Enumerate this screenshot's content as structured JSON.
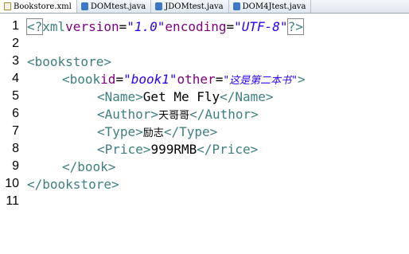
{
  "tabs": [
    {
      "label": "Bookstore.xml",
      "icon": "xml-file-icon",
      "active": true
    },
    {
      "label": "DOMtest.java",
      "icon": "java-file-icon",
      "active": false
    },
    {
      "label": "JDOMtest.java",
      "icon": "java-file-icon",
      "active": false
    },
    {
      "label": "DOM4Jtest.java",
      "icon": "java-file-icon",
      "active": false
    }
  ],
  "editor": {
    "line_numbers": [
      "1",
      "2",
      "3",
      "4",
      "5",
      "6",
      "7",
      "8",
      "9",
      "10",
      "11"
    ],
    "lines": {
      "l1": {
        "open": "<?",
        "decl": "xml",
        "attr1": "version",
        "eq1": "=",
        "val1": "\"1.0\"",
        "attr2": "encoding",
        "eq2": "=",
        "val2": "\"UTF-8\"",
        "close": "?>"
      },
      "l3": {
        "tag": "<bookstore>"
      },
      "l4": {
        "open": "<book",
        "attr1": "id",
        "eq1": "=",
        "val1": "\"book1\"",
        "attr2": "other",
        "eq2": "=",
        "val2": "\"这是第二本书\"",
        "close": ">"
      },
      "l5": {
        "open": "<Name>",
        "text": "Get Me Fly",
        "close": "</Name>"
      },
      "l6": {
        "open": "<Author>",
        "text": "天哥哥",
        "close": "</Author>"
      },
      "l7": {
        "open": "<Type>",
        "text": "励志",
        "close": "</Type>"
      },
      "l8": {
        "open": "<Price>",
        "text": "999RMB",
        "close": "</Price>"
      },
      "l9": {
        "tag": "</book>"
      },
      "l10": {
        "tag": "</bookstore>"
      }
    }
  },
  "colors": {
    "tag": "#3f7f7f",
    "attribute": "#7f007f",
    "value": "#2a00ff",
    "text": "#000000"
  }
}
